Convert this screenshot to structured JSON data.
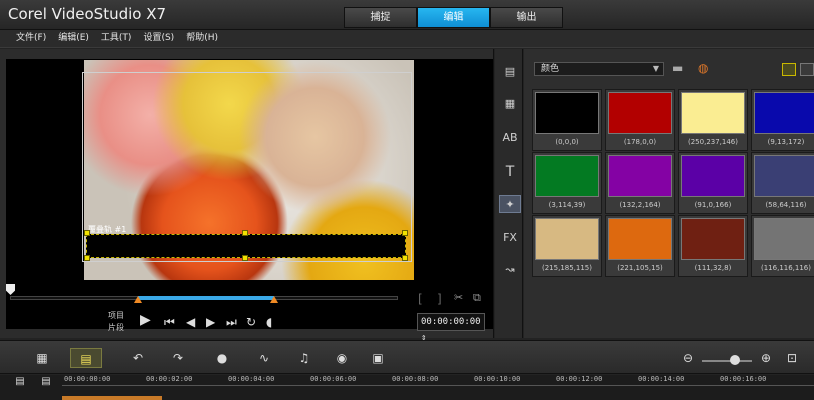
{
  "app": {
    "title": "Corel VideoStudio X7"
  },
  "mode_tabs": [
    {
      "label": "捕捉",
      "active": false
    },
    {
      "label": "编辑",
      "active": true
    },
    {
      "label": "输出",
      "active": false
    }
  ],
  "menu": [
    "文件(F)",
    "编辑(E)",
    "工具(T)",
    "设置(S)",
    "帮助(H)"
  ],
  "preview": {
    "overlay_label": "覆叠轨 #1",
    "labels": {
      "project": "项目",
      "clip": "片段"
    },
    "timecode": "00:00:00:00 ⇕"
  },
  "library": {
    "category": "颜色",
    "icons": [
      "media-icon",
      "instant-project-icon",
      "transition-icon",
      "title-icon",
      "graphic-icon",
      "filter-icon",
      "path-icon"
    ],
    "swatches": [
      {
        "color": "#000000",
        "label": "(0,0,0)"
      },
      {
        "color": "#b20000",
        "label": "(178,0,0)"
      },
      {
        "color": "#faed92",
        "label": "(250,237,146)"
      },
      {
        "color": "#0909ac",
        "label": "(9,13,172)"
      },
      {
        "color": "#037a22",
        "label": "(3,114,39)"
      },
      {
        "color": "#8402a4",
        "label": "(132,2,164)"
      },
      {
        "color": "#5b00a6",
        "label": "(91,0,166)"
      },
      {
        "color": "#3a3f74",
        "label": "(58,64,116)"
      },
      {
        "color": "#d7b982",
        "label": "(215,185,115)"
      },
      {
        "color": "#dd690f",
        "label": "(221,105,15)"
      },
      {
        "color": "#6f2012",
        "label": "(111,32,8)"
      },
      {
        "color": "#747474",
        "label": "(116,116,116)"
      }
    ]
  },
  "timeline": {
    "ticks": [
      "00:00:00:00",
      "00:00:02:00",
      "00:00:04:00",
      "00:00:06:00",
      "00:00:08:00",
      "00:00:10:00",
      "00:00:12:00",
      "00:00:14:00",
      "00:00:16:00"
    ]
  },
  "colors": {
    "accent": "#1aa3e6",
    "highlight": "#f2e200"
  }
}
